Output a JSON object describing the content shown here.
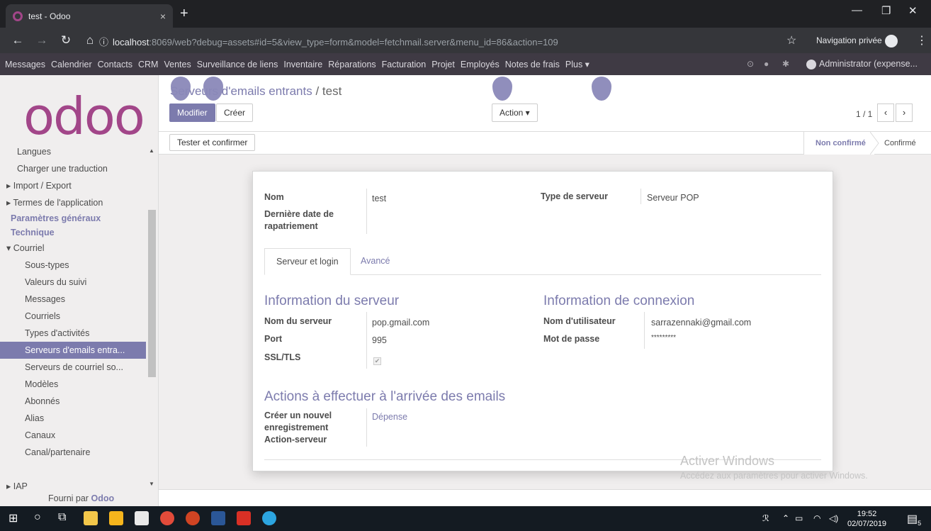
{
  "browser": {
    "tab_title": "test - Odoo",
    "tab_close": "×",
    "new_tab": "+",
    "url_host": "localhost",
    "url_rest": ":8069/web?debug=assets#id=5&view_type=form&model=fetchmail.server&menu_id=86&action=109",
    "private_label": "Navigation privée",
    "window_min": "—",
    "window_restore": "❐",
    "window_close": "✕"
  },
  "main_menu": {
    "items": [
      "Messages",
      "Calendrier",
      "Contacts",
      "CRM",
      "Ventes",
      "Surveillance de liens",
      "Inventaire",
      "Réparations",
      "Facturation",
      "Projet",
      "Employés",
      "Notes de frais",
      "Plus ▾"
    ],
    "user": "Administrator (expense..."
  },
  "sidebar": {
    "logo": "odoo",
    "items": [
      {
        "label": "Langues",
        "kind": "lvl1"
      },
      {
        "label": "Charger une traduction",
        "kind": "lvl1"
      },
      {
        "label": "▸ Import / Export",
        "kind": "arrow"
      },
      {
        "label": "▸ Termes de l'application",
        "kind": "arrow"
      },
      {
        "label": "Paramètres généraux",
        "kind": "hdr"
      },
      {
        "label": "Technique",
        "kind": "hdr"
      },
      {
        "label": "▾ Courriel",
        "kind": "arrow"
      },
      {
        "label": "Sous-types",
        "kind": "lvl2"
      },
      {
        "label": "Valeurs du suivi",
        "kind": "lvl2"
      },
      {
        "label": "Messages",
        "kind": "lvl2"
      },
      {
        "label": "Courriels",
        "kind": "lvl2"
      },
      {
        "label": "Types d'activités",
        "kind": "lvl2"
      },
      {
        "label": "Serveurs d'emails entra...",
        "kind": "active"
      },
      {
        "label": "Serveurs de courriel so...",
        "kind": "lvl2"
      },
      {
        "label": "Modèles",
        "kind": "lvl2"
      },
      {
        "label": "Abonnés",
        "kind": "lvl2"
      },
      {
        "label": "Alias",
        "kind": "lvl2"
      },
      {
        "label": "Canaux",
        "kind": "lvl2"
      },
      {
        "label": "Canal/partenaire",
        "kind": "lvl2"
      },
      {
        "label": "",
        "kind": "lvl2"
      },
      {
        "label": "▸ IAP",
        "kind": "arrow"
      }
    ],
    "powered_prefix": "Fourni par",
    "powered_brand": "Odoo"
  },
  "control": {
    "breadcrumb_parent": "Serveurs d'emails entrants",
    "breadcrumb_sep": " / ",
    "breadcrumb_current": "test",
    "edit_label": "Modifier",
    "create_label": "Créer",
    "action_label": "Action ▾",
    "pager": "1 / 1",
    "prev": "‹",
    "next": "›"
  },
  "statusbar": {
    "test_button": "Tester et confirmer",
    "stage_active": "Non confirmé",
    "stage_next": "Confirmé"
  },
  "form": {
    "name_label": "Nom",
    "name_value": "test",
    "last_fetch_label": "Dernière date de rapatriement",
    "server_type_label": "Type de serveur",
    "server_type_value": "Serveur POP",
    "tab_server": "Serveur et login",
    "tab_advanced": "Avancé",
    "server_info_title": "Information du serveur",
    "server_name_label": "Nom du serveur",
    "server_name_value": "pop.gmail.com",
    "port_label": "Port",
    "port_value": "995",
    "ssl_label": "SSL/TLS",
    "ssl_checked": "✔",
    "login_info_title": "Information de connexion",
    "username_label": "Nom d'utilisateur",
    "username_value": "sarrazennaki@gmail.com",
    "password_label": "Mot de passe",
    "password_value": "*********",
    "actions_title": "Actions à effectuer à l'arrivée des emails",
    "create_record_label": "Créer un nouvel enregistrement",
    "create_record_value": "Dépense",
    "server_action_label": "Action-serveur"
  },
  "watermark": {
    "line1": "Activer Windows",
    "line2": "Accédez aux paramètres pour activer Windows."
  },
  "taskbar": {
    "time": "19:52",
    "date": "02/07/2019",
    "notif_count": "5"
  },
  "colors": {
    "brand": "#7c7bad",
    "odoo_logo": "#a24689",
    "menu_bg": "#3f3a44"
  }
}
